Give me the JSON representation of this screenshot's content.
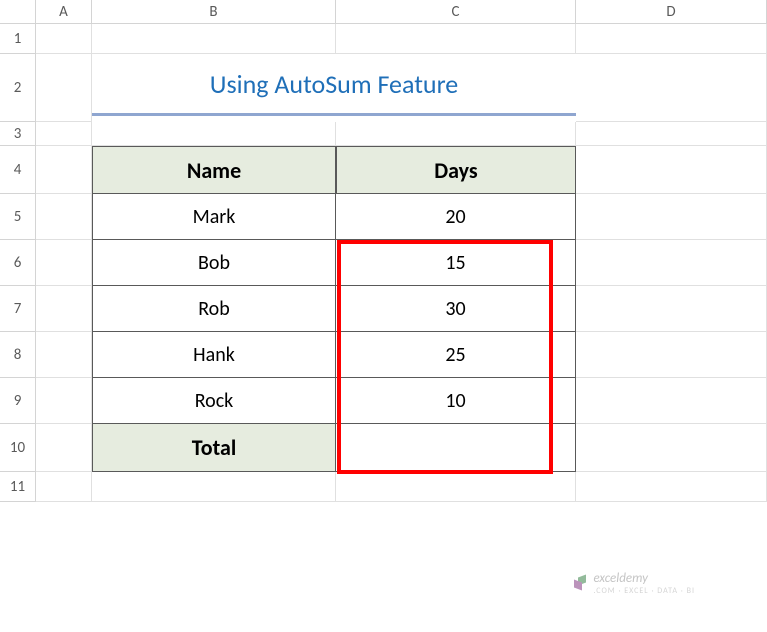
{
  "columns": [
    "",
    "A",
    "B",
    "C",
    "D"
  ],
  "rows": [
    "1",
    "2",
    "3",
    "4",
    "5",
    "6",
    "7",
    "8",
    "9",
    "10",
    "11"
  ],
  "title": "Using AutoSum Feature",
  "headers": {
    "name": "Name",
    "days": "Days"
  },
  "data": [
    {
      "name": "Mark",
      "days": "20"
    },
    {
      "name": "Bob",
      "days": "15"
    },
    {
      "name": "Rob",
      "days": "30"
    },
    {
      "name": "Hank",
      "days": "25"
    },
    {
      "name": "Rock",
      "days": "10"
    }
  ],
  "total_label": "Total",
  "total_value": "",
  "watermark": {
    "brand": "exceldemy",
    "tagline": ".COM · EXCEL · DATA · BI"
  },
  "chart_data": {
    "type": "table",
    "title": "Using AutoSum Feature",
    "columns": [
      "Name",
      "Days"
    ],
    "rows": [
      [
        "Mark",
        20
      ],
      [
        "Bob",
        15
      ],
      [
        "Rob",
        30
      ],
      [
        "Hank",
        25
      ],
      [
        "Rock",
        10
      ]
    ],
    "total_row": [
      "Total",
      null
    ]
  }
}
